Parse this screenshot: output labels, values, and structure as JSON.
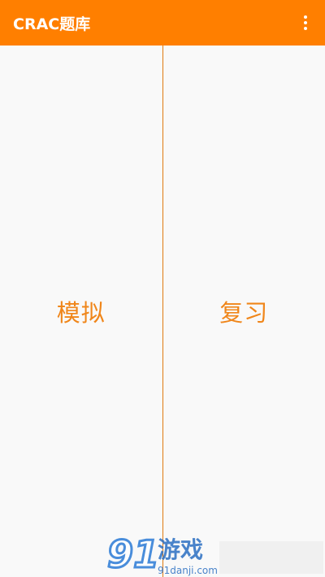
{
  "appbar": {
    "title": "CRAC题库",
    "background_color": "#ff7f00",
    "menu_icon": "overflow-menu-icon"
  },
  "main": {
    "left_button_label": "模拟",
    "right_button_label": "复习",
    "label_color": "#f0861a"
  },
  "watermark": {
    "brand_text": "游戏",
    "site_text": "91danji.com"
  }
}
